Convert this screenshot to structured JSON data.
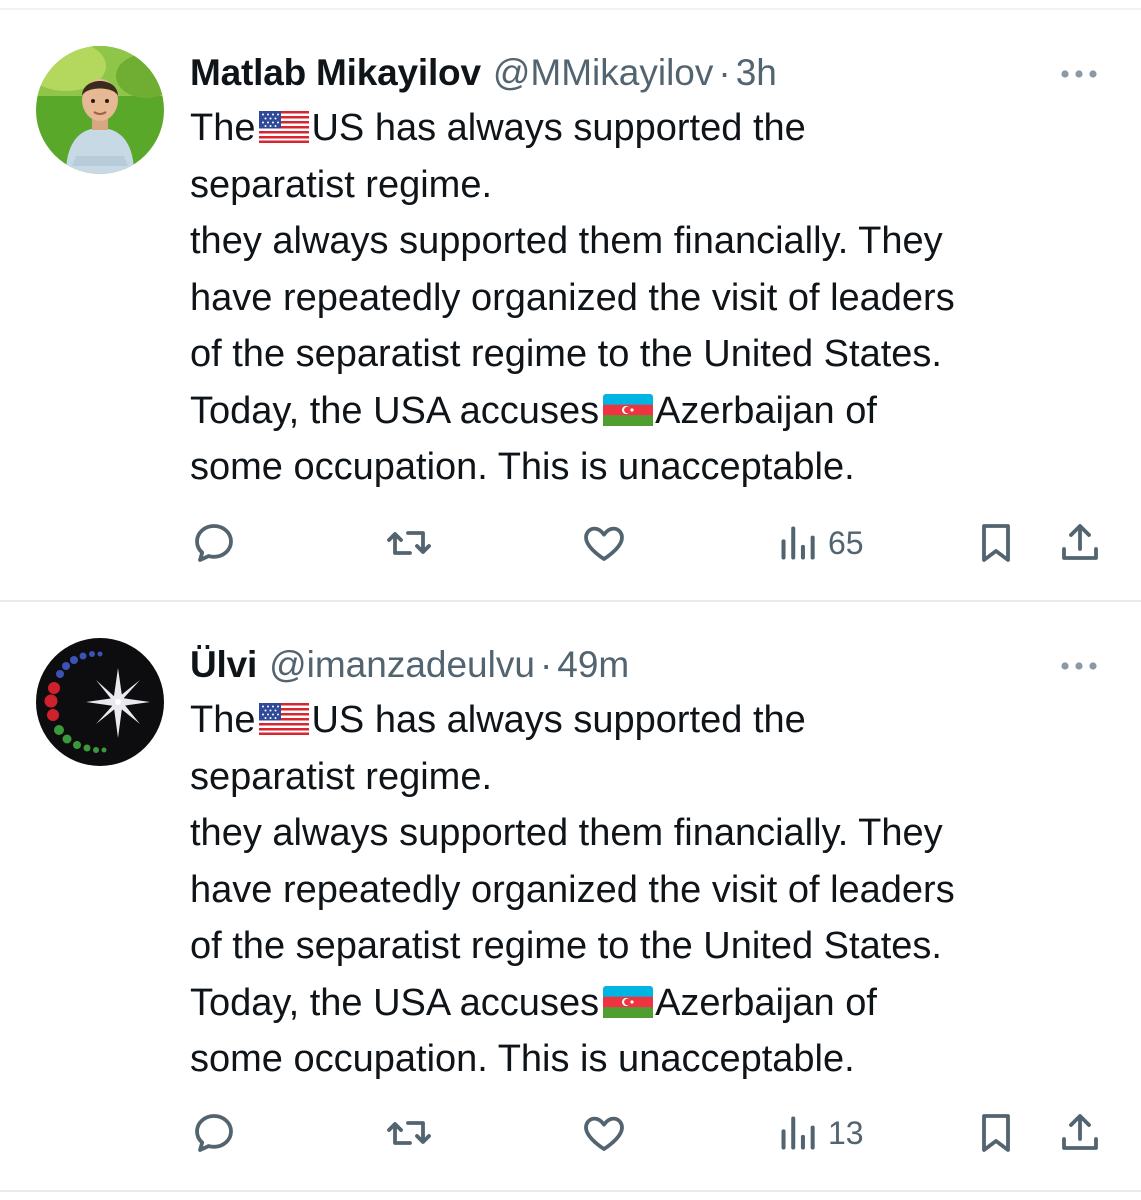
{
  "tweets": [
    {
      "name": "Matlab Mikayilov",
      "handle": "@MMikayilov",
      "separator": "·",
      "time": "3h",
      "text": {
        "l1_a": "The",
        "l1_b": "US has always supported the",
        "l2": "separatist regime.",
        "l3": "they always supported them financially. They",
        "l4": "have repeatedly organized the visit of leaders",
        "l5": "of the separatist regime to the United States.",
        "l6_a": "Today, the USA accuses",
        "l6_b": "Azerbaijan of",
        "l7": "some occupation. This is unacceptable."
      },
      "views": "65",
      "avatar_icon": "avatar-boy-photo"
    },
    {
      "name": "Ülvi",
      "handle": "@imanzadeulvu",
      "separator": "·",
      "time": "49m",
      "text": {
        "l1_a": "The",
        "l1_b": "US has always supported the",
        "l2": "separatist regime.",
        "l3": "they always supported them financially. They",
        "l4": "have repeatedly organized the visit of leaders",
        "l5": "of the separatist regime to the United States.",
        "l6_a": "Today, the USA accuses",
        "l6_b": "Azerbaijan of",
        "l7": "some occupation. This is unacceptable."
      },
      "views": "13",
      "avatar_icon": "avatar-crescent-star"
    }
  ],
  "icons": {
    "us_flag": "us-flag-emoji",
    "az_flag": "azerbaijan-flag-emoji",
    "reply": "reply-icon",
    "retweet": "retweet-icon",
    "like": "heart-icon",
    "views": "views-chart-icon",
    "bookmark": "bookmark-icon",
    "share": "share-icon",
    "more": "more-options-icon"
  },
  "colors": {
    "text": "#0f1419",
    "secondary": "#536471",
    "divider": "#e7e9ea"
  }
}
